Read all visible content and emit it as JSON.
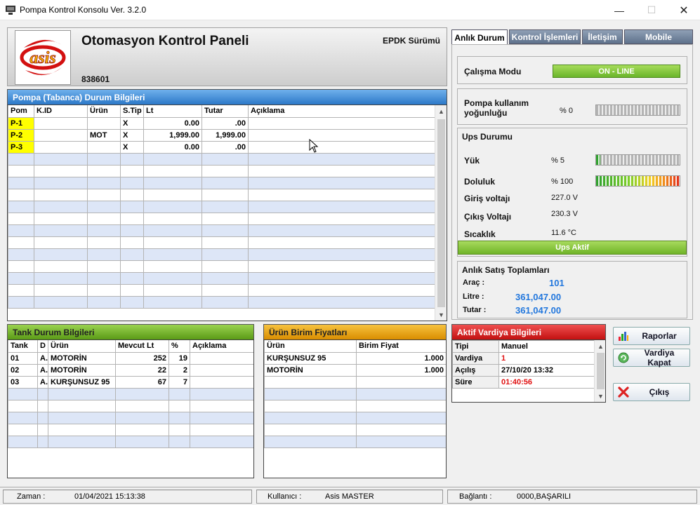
{
  "window": {
    "title": "Pompa Kontrol Konsolu Ver. 3.2.0"
  },
  "header": {
    "title": "Otomasyon Kontrol Paneli",
    "version": "EPDK Sürümü",
    "code": "838601",
    "logo_text": "asis"
  },
  "pump": {
    "title": "Pompa (Tabanca) Durum Bilgileri",
    "columns": [
      "Pom",
      "K.ID",
      "Ürün",
      "S.Tip",
      "Lt",
      "Tutar",
      "Açıklama"
    ],
    "rows": [
      [
        "P-1",
        "",
        "",
        "X",
        "0.00",
        ".00",
        ""
      ],
      [
        "P-2",
        "",
        "MOT",
        "X",
        "1,999.00",
        "1,999.00",
        ""
      ],
      [
        "P-3",
        "",
        "",
        "X",
        "0.00",
        ".00",
        ""
      ]
    ]
  },
  "tank": {
    "title": "Tank Durum Bilgileri",
    "columns": [
      "Tank",
      "D",
      "Ürün",
      "Mevcut Lt",
      "%",
      "Açıklama"
    ],
    "rows": [
      [
        "01",
        "A.",
        "MOTORİN",
        "252",
        "19",
        ""
      ],
      [
        "02",
        "A.",
        "MOTORİN",
        "22",
        "2",
        ""
      ],
      [
        "03",
        "A.",
        "KURŞUNSUZ 95",
        "67",
        "7",
        ""
      ]
    ]
  },
  "prices": {
    "title": "Ürün Birim Fiyatları",
    "columns": [
      "Ürün",
      "Birim Fiyat"
    ],
    "rows": [
      [
        "KURŞUNSUZ 95",
        "1.000"
      ],
      [
        "MOTORİN",
        "1.000"
      ]
    ]
  },
  "shift": {
    "title": "Aktif Vardiya Bilgileri",
    "rows": [
      {
        "label": "Tipi",
        "value": "Manuel",
        "red": false
      },
      {
        "label": "Vardiya",
        "value": "1",
        "red": true
      },
      {
        "label": "Açılış",
        "value": "27/10/20 13:32",
        "red": false
      },
      {
        "label": "Süre",
        "value": "01:40:56",
        "red": true
      }
    ]
  },
  "tabs": [
    {
      "label": "Anlık Durum",
      "active": true
    },
    {
      "label": "Kontrol İşlemleri",
      "active": false
    },
    {
      "label": "İletişim",
      "active": false
    },
    {
      "label": "Mobile",
      "active": false
    }
  ],
  "status_panel": {
    "mode_label": "Çalışma Modu",
    "mode_value": "ON - LINE",
    "usage_label": "Pompa kullanım yoğunluğu",
    "usage_value": "% 0",
    "usage_level": 0,
    "ups_title": "Ups Durumu",
    "load_label": "Yük",
    "load_value": "% 5",
    "load_level": 5,
    "fill_label": "Doluluk",
    "fill_value": "% 100",
    "fill_level": 100,
    "in_volt_label": "Giriş voltajı",
    "in_volt_value": "227.0 V",
    "out_volt_label": "Çıkış Voltajı",
    "out_volt_value": "230.3 V",
    "temp_label": "Sıcaklık",
    "temp_value": "11.6 °C",
    "ups_status": "Ups Aktif"
  },
  "sales": {
    "title": "Anlık Satış Toplamları",
    "vehicle_label": "Araç :",
    "vehicle_value": "101",
    "liter_label": "Litre :",
    "liter_value": "361,047.00",
    "amount_label": "Tutar :",
    "amount_value": "361,047.00"
  },
  "buttons": {
    "reports": "Raporlar",
    "close_shift": "Vardiya Kapat",
    "exit": "Çıkış"
  },
  "statusbar": {
    "time_label": "Zaman :",
    "time_value": "01/04/2021 15:13:38",
    "user_label": "Kullanıcı :",
    "user_value": "Asis MASTER",
    "conn_label": "Bağlantı :",
    "conn_value": "0000,BAŞARILI"
  }
}
